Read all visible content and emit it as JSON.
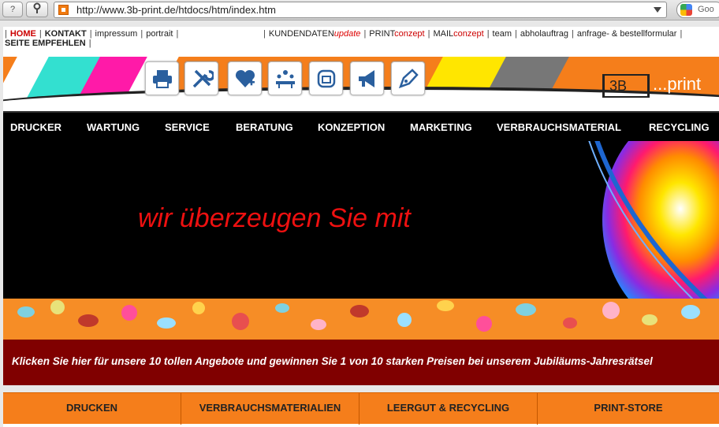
{
  "browser": {
    "back_label": "?",
    "url": "http://www.3b-print.de/htdocs/htm/index.htm",
    "search_placeholder": "Goo"
  },
  "topnav": {
    "home": "HOME",
    "kontakt": "KONTAKT",
    "impressum": "impressum",
    "portrait": "portrait",
    "seite_empfehlen": "SEITE EMPFEHLEN",
    "kundendaten": "KUNDENDATEN",
    "kundendaten_suffix": "update",
    "print": "PRINT",
    "print_suffix": "conzept",
    "mail": "MAIL",
    "mail_suffix": "conzept",
    "team": "team",
    "abholauftrag": "abholauftrag",
    "anfrage": "anfrage- & bestellformular"
  },
  "header": {
    "icons": [
      "printer-icon",
      "tools-icon",
      "heart-plus-icon",
      "meeting-icon",
      "document-icon",
      "megaphone-icon",
      "pen-nib-icon"
    ],
    "logo_box": "3B",
    "logo_text": "...print",
    "colors": {
      "cyan": "#33e0d0",
      "magenta": "#ff1aa8",
      "yellow": "#ffe600",
      "orange": "#f57e1b"
    }
  },
  "mainnav": [
    "DRUCKER",
    "WARTUNG",
    "SERVICE",
    "BERATUNG",
    "KONZEPTION",
    "MARKETING",
    "VERBRAUCHSMATERIAL",
    "RECYCLING"
  ],
  "hero": {
    "headline": "wir überzeugen Sie mit"
  },
  "promo": {
    "text": "Klicken Sie hier für unsere 10 tollen Angebote und gewinnen Sie 1 von 10 starken Preisen bei unserem Jubiläums-Jahresrätsel"
  },
  "bottomnav": [
    "DRUCKEN",
    "VERBRAUCHSMATERIALIEN",
    "LEERGUT & RECYCLING",
    "PRINT-STORE"
  ]
}
